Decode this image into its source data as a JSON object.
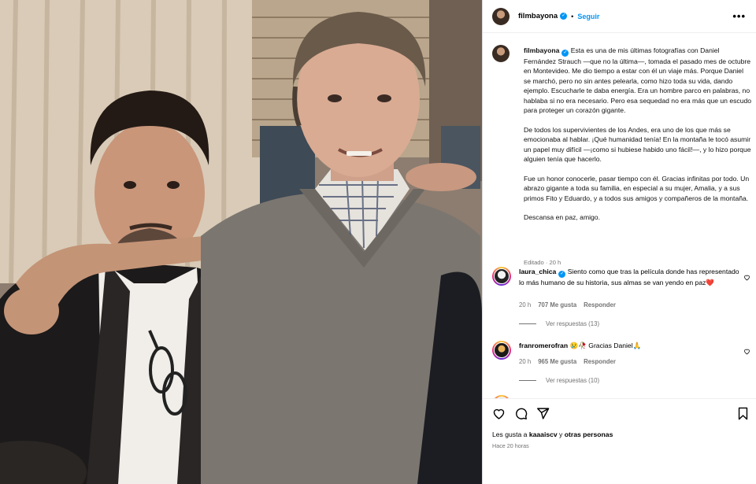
{
  "post": {
    "username": "filmbayona",
    "follow_label": "Seguir",
    "dot": "•",
    "more_label": "•••",
    "caption_paragraphs": [
      "Esta es una de mis últimas fotografías con Daniel Fernández Strauch —que no la última—, tomada el pasado mes de octubre en Montevideo. Me dio tiempo a estar con él un viaje más. Porque Daniel se marchó, pero no sin antes pelearla, como hizo toda su vida, dando ejemplo. Escucharle te daba energía. Era un hombre parco en palabras, no hablaba si no era necesario. Pero esa sequedad no era más que un escudo para proteger un corazón gigante.",
      "De todos los supervivientes de los Andes, era uno de los que más se emocionaba al hablar. ¡Qué humanidad tenía! En la montaña le tocó asumir un papel muy difícil —¡como si hubiese habido uno fácil!—, y lo hizo porque alguien tenía que hacerlo.",
      "Fue un honor conocerle, pasar tiempo con él. Gracias infinitas por todo. Un abrazo gigante a toda su familia, en especial a su mujer, Amalia, y a sus primos Fito y Eduardo, y a todos sus amigos y compañeros de la montaña.",
      "Descansa en paz, amigo."
    ],
    "edited": "Editado · 20 h",
    "likes_prefix": "Les gusta a ",
    "likes_user": "kaaaiscv",
    "likes_mid": " y ",
    "likes_others": "otras personas",
    "time_ago": "Hace 20 horas"
  },
  "comments": [
    {
      "username": "laura_chica",
      "verified": true,
      "text": "Siento como que tras la película donde has representado lo más humano de su historia, sus almas se van yendo en paz❤️",
      "time": "20 h",
      "likes": "707 Me gusta",
      "reply": "Responder",
      "view_replies": "Ver respuestas (13)"
    },
    {
      "username": "franromerofran",
      "verified": false,
      "text": "😢🥀 Gracias Daniel🙏",
      "time": "20 h",
      "likes": "965 Me gusta",
      "reply": "Responder",
      "view_replies": "Ver respuestas (10)"
    }
  ],
  "icons": [
    "heart-icon",
    "comment-icon",
    "share-icon",
    "bookmark-icon",
    "more-icon",
    "verified-icon"
  ],
  "colors": {
    "accent": "#0095f6",
    "muted": "#737373",
    "border": "#dbdbdb"
  }
}
